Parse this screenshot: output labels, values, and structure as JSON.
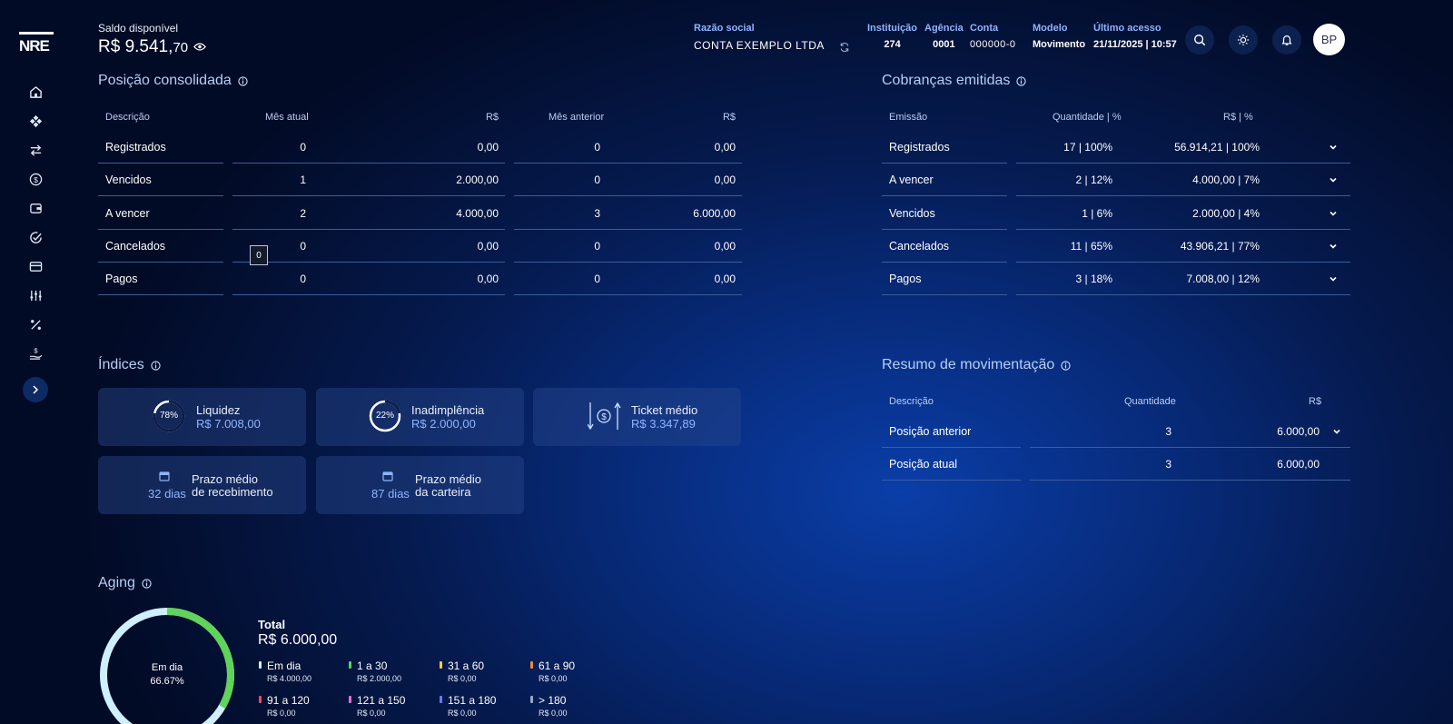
{
  "header": {
    "saldo_label": "Saldo disponível",
    "saldo_main": "R$ 9.541,",
    "saldo_cents": "70",
    "razao_label": "Razão social",
    "razao_value": "CONTA EXEMPLO LTDA",
    "instituicao_label": "Instituição",
    "instituicao_value": "274",
    "agencia_label": "Agência",
    "agencia_value": "0001",
    "conta_label": "Conta",
    "conta_value": "000000-0",
    "modelo_label": "Modelo",
    "modelo_value": "Movimento",
    "acesso_label": "Último acesso",
    "acesso_value": "21/11/2025 | 10:57",
    "avatar_initials": "BP"
  },
  "posicao": {
    "title": "Posição consolidada",
    "headers": [
      "Descrição",
      "Mês atual",
      "R$",
      "Mês anterior",
      "R$"
    ],
    "rows": [
      [
        "Registrados",
        "0",
        "0,00",
        "0",
        "0,00"
      ],
      [
        "Vencidos",
        "1",
        "2.000,00",
        "0",
        "0,00"
      ],
      [
        "A vencer",
        "2",
        "4.000,00",
        "3",
        "6.000,00"
      ],
      [
        "Cancelados",
        "0",
        "0,00",
        "0",
        "0,00"
      ],
      [
        "Pagos",
        "0",
        "0,00",
        "0",
        "0,00"
      ]
    ],
    "tooltip": "0"
  },
  "cobrancas": {
    "title": "Cobranças emitidas",
    "headers": [
      "Emissão",
      "Quantidade | %",
      "R$ | %"
    ],
    "rows": [
      [
        "Registrados",
        "17 | 100%",
        "56.914,21 | 100%"
      ],
      [
        "A vencer",
        "2 | 12%",
        "4.000,00 | 7%"
      ],
      [
        "Vencidos",
        "1 | 6%",
        "2.000,00 | 4%"
      ],
      [
        "Cancelados",
        "11 | 65%",
        "43.906,21 | 77%"
      ],
      [
        "Pagos",
        "3 | 18%",
        "7.008,00 | 12%"
      ]
    ]
  },
  "indices": {
    "title": "Índices",
    "liquidez": {
      "percent_label": "78%",
      "percent": 78,
      "label": "Liquidez",
      "value": "R$ 7.008,00"
    },
    "inadimplencia": {
      "percent_label": "22%",
      "percent": 22,
      "label": "Inadimplência",
      "value": "R$ 2.000,00"
    },
    "ticket": {
      "label": "Ticket médio",
      "value": "R$ 3.347,89"
    },
    "prazo_recebimento": {
      "days": "32 dias",
      "line1": "Prazo médio",
      "line2": "de recebimento"
    },
    "prazo_carteira": {
      "days": "87 dias",
      "line1": "Prazo médio",
      "line2": "da carteira"
    }
  },
  "resumo": {
    "title": "Resumo de movimentação",
    "headers": [
      "Descrição",
      "Quantidade",
      "R$"
    ],
    "rows": [
      [
        "Posição anterior",
        "3",
        "6.000,00"
      ],
      [
        "Posição atual",
        "3",
        "6.000,00"
      ]
    ]
  },
  "aging": {
    "title": "Aging",
    "center_label": "Em dia",
    "center_percent": "66.67%",
    "donut_fraction": 0.6667,
    "total_label": "Total",
    "total_value": "R$ 6.000,00",
    "buckets": [
      {
        "name": "Em dia",
        "value": "R$ 4.000,00",
        "color": "#cfefff"
      },
      {
        "name": "1 a 30",
        "value": "R$ 2.000,00",
        "color": "#5fd35a"
      },
      {
        "name": "31 a 60",
        "value": "R$ 0,00",
        "color": "#f2d13a"
      },
      {
        "name": "61 a 90",
        "value": "R$ 0,00",
        "color": "#f08a3a"
      },
      {
        "name": "91 a 120",
        "value": "R$ 0,00",
        "color": "#ef4b5b"
      },
      {
        "name": "121 a 150",
        "value": "R$ 0,00",
        "color": "#e070d0"
      },
      {
        "name": "151 a 180",
        "value": "R$ 0,00",
        "color": "#6a7cf0"
      },
      {
        "name": "> 180",
        "value": "R$ 0,00",
        "color": "#9aa8c8"
      }
    ]
  },
  "colors": {
    "accent": "#8fb3ff",
    "ring_track": "#ffffff",
    "ring_fill": "#0b1b45",
    "donut_green": "#5fd35a",
    "donut_light": "#cfefff"
  }
}
